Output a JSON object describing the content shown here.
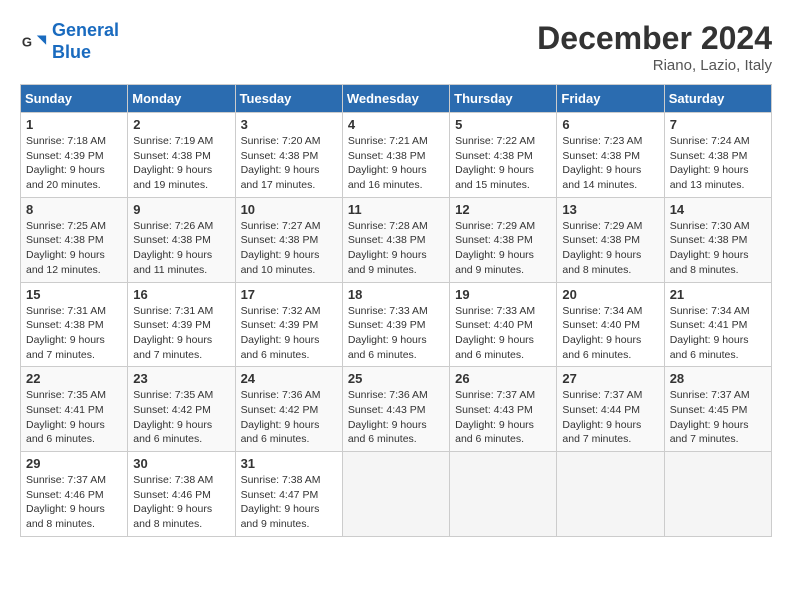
{
  "header": {
    "logo_line1": "General",
    "logo_line2": "Blue",
    "month_title": "December 2024",
    "location": "Riano, Lazio, Italy"
  },
  "days_of_week": [
    "Sunday",
    "Monday",
    "Tuesday",
    "Wednesday",
    "Thursday",
    "Friday",
    "Saturday"
  ],
  "weeks": [
    [
      {
        "day": "1",
        "sunrise": "Sunrise: 7:18 AM",
        "sunset": "Sunset: 4:39 PM",
        "daylight": "Daylight: 9 hours and 20 minutes."
      },
      {
        "day": "2",
        "sunrise": "Sunrise: 7:19 AM",
        "sunset": "Sunset: 4:38 PM",
        "daylight": "Daylight: 9 hours and 19 minutes."
      },
      {
        "day": "3",
        "sunrise": "Sunrise: 7:20 AM",
        "sunset": "Sunset: 4:38 PM",
        "daylight": "Daylight: 9 hours and 17 minutes."
      },
      {
        "day": "4",
        "sunrise": "Sunrise: 7:21 AM",
        "sunset": "Sunset: 4:38 PM",
        "daylight": "Daylight: 9 hours and 16 minutes."
      },
      {
        "day": "5",
        "sunrise": "Sunrise: 7:22 AM",
        "sunset": "Sunset: 4:38 PM",
        "daylight": "Daylight: 9 hours and 15 minutes."
      },
      {
        "day": "6",
        "sunrise": "Sunrise: 7:23 AM",
        "sunset": "Sunset: 4:38 PM",
        "daylight": "Daylight: 9 hours and 14 minutes."
      },
      {
        "day": "7",
        "sunrise": "Sunrise: 7:24 AM",
        "sunset": "Sunset: 4:38 PM",
        "daylight": "Daylight: 9 hours and 13 minutes."
      }
    ],
    [
      {
        "day": "8",
        "sunrise": "Sunrise: 7:25 AM",
        "sunset": "Sunset: 4:38 PM",
        "daylight": "Daylight: 9 hours and 12 minutes."
      },
      {
        "day": "9",
        "sunrise": "Sunrise: 7:26 AM",
        "sunset": "Sunset: 4:38 PM",
        "daylight": "Daylight: 9 hours and 11 minutes."
      },
      {
        "day": "10",
        "sunrise": "Sunrise: 7:27 AM",
        "sunset": "Sunset: 4:38 PM",
        "daylight": "Daylight: 9 hours and 10 minutes."
      },
      {
        "day": "11",
        "sunrise": "Sunrise: 7:28 AM",
        "sunset": "Sunset: 4:38 PM",
        "daylight": "Daylight: 9 hours and 9 minutes."
      },
      {
        "day": "12",
        "sunrise": "Sunrise: 7:29 AM",
        "sunset": "Sunset: 4:38 PM",
        "daylight": "Daylight: 9 hours and 9 minutes."
      },
      {
        "day": "13",
        "sunrise": "Sunrise: 7:29 AM",
        "sunset": "Sunset: 4:38 PM",
        "daylight": "Daylight: 9 hours and 8 minutes."
      },
      {
        "day": "14",
        "sunrise": "Sunrise: 7:30 AM",
        "sunset": "Sunset: 4:38 PM",
        "daylight": "Daylight: 9 hours and 8 minutes."
      }
    ],
    [
      {
        "day": "15",
        "sunrise": "Sunrise: 7:31 AM",
        "sunset": "Sunset: 4:38 PM",
        "daylight": "Daylight: 9 hours and 7 minutes."
      },
      {
        "day": "16",
        "sunrise": "Sunrise: 7:31 AM",
        "sunset": "Sunset: 4:39 PM",
        "daylight": "Daylight: 9 hours and 7 minutes."
      },
      {
        "day": "17",
        "sunrise": "Sunrise: 7:32 AM",
        "sunset": "Sunset: 4:39 PM",
        "daylight": "Daylight: 9 hours and 6 minutes."
      },
      {
        "day": "18",
        "sunrise": "Sunrise: 7:33 AM",
        "sunset": "Sunset: 4:39 PM",
        "daylight": "Daylight: 9 hours and 6 minutes."
      },
      {
        "day": "19",
        "sunrise": "Sunrise: 7:33 AM",
        "sunset": "Sunset: 4:40 PM",
        "daylight": "Daylight: 9 hours and 6 minutes."
      },
      {
        "day": "20",
        "sunrise": "Sunrise: 7:34 AM",
        "sunset": "Sunset: 4:40 PM",
        "daylight": "Daylight: 9 hours and 6 minutes."
      },
      {
        "day": "21",
        "sunrise": "Sunrise: 7:34 AM",
        "sunset": "Sunset: 4:41 PM",
        "daylight": "Daylight: 9 hours and 6 minutes."
      }
    ],
    [
      {
        "day": "22",
        "sunrise": "Sunrise: 7:35 AM",
        "sunset": "Sunset: 4:41 PM",
        "daylight": "Daylight: 9 hours and 6 minutes."
      },
      {
        "day": "23",
        "sunrise": "Sunrise: 7:35 AM",
        "sunset": "Sunset: 4:42 PM",
        "daylight": "Daylight: 9 hours and 6 minutes."
      },
      {
        "day": "24",
        "sunrise": "Sunrise: 7:36 AM",
        "sunset": "Sunset: 4:42 PM",
        "daylight": "Daylight: 9 hours and 6 minutes."
      },
      {
        "day": "25",
        "sunrise": "Sunrise: 7:36 AM",
        "sunset": "Sunset: 4:43 PM",
        "daylight": "Daylight: 9 hours and 6 minutes."
      },
      {
        "day": "26",
        "sunrise": "Sunrise: 7:37 AM",
        "sunset": "Sunset: 4:43 PM",
        "daylight": "Daylight: 9 hours and 6 minutes."
      },
      {
        "day": "27",
        "sunrise": "Sunrise: 7:37 AM",
        "sunset": "Sunset: 4:44 PM",
        "daylight": "Daylight: 9 hours and 7 minutes."
      },
      {
        "day": "28",
        "sunrise": "Sunrise: 7:37 AM",
        "sunset": "Sunset: 4:45 PM",
        "daylight": "Daylight: 9 hours and 7 minutes."
      }
    ],
    [
      {
        "day": "29",
        "sunrise": "Sunrise: 7:37 AM",
        "sunset": "Sunset: 4:46 PM",
        "daylight": "Daylight: 9 hours and 8 minutes."
      },
      {
        "day": "30",
        "sunrise": "Sunrise: 7:38 AM",
        "sunset": "Sunset: 4:46 PM",
        "daylight": "Daylight: 9 hours and 8 minutes."
      },
      {
        "day": "31",
        "sunrise": "Sunrise: 7:38 AM",
        "sunset": "Sunset: 4:47 PM",
        "daylight": "Daylight: 9 hours and 9 minutes."
      },
      null,
      null,
      null,
      null
    ]
  ]
}
